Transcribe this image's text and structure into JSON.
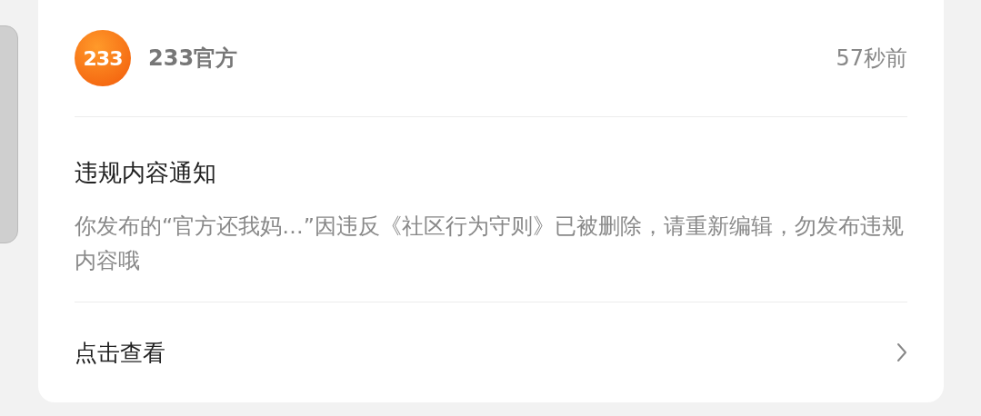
{
  "notice": {
    "logo_text": "233",
    "sender": "233官方",
    "time": "57秒前",
    "title": "违规内容通知",
    "body": "你发布的“官方还我妈…”因违反《社区行为守则》已被删除，请重新编辑，勿发布违规内容哦",
    "link": "点击查看"
  }
}
